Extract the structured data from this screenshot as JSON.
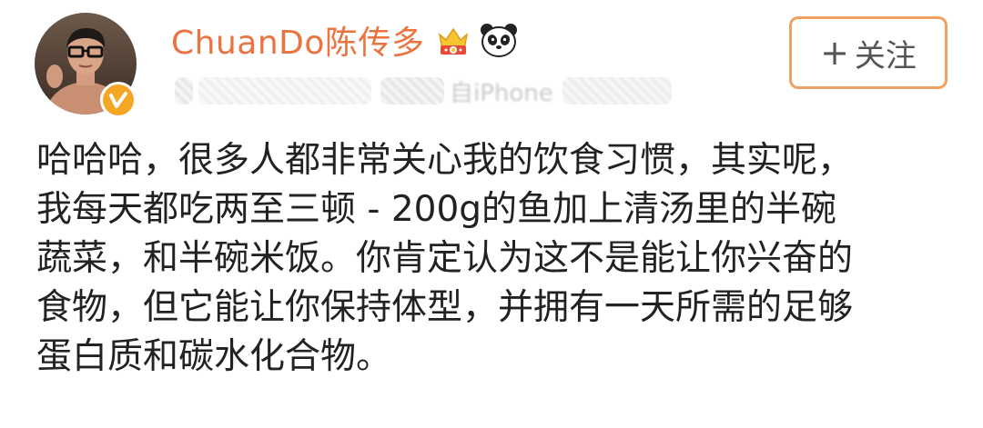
{
  "post": {
    "username": "ChuanDo陈传多",
    "meta_visible_fragment": "自iPhone",
    "follow_label": "关注",
    "follow_plus": "+",
    "body_lines": [
      "哈哈哈，很多人都非常关心我的饮食习惯，其实呢，",
      "我每天都吃两至三顿 - 200g的鱼加上清汤里的半碗",
      "蔬菜，和半碗米饭。你肯定认为这不是能让你兴奋的",
      "食物，但它能让你保持体型，并拥有一天所需的足够",
      "蛋白质和碳水化合物。"
    ]
  },
  "icons": {
    "avatar": "user-avatar",
    "verified": "verified-badge-icon",
    "vip": "crown-badge-icon",
    "panda": "panda-icon"
  },
  "colors": {
    "username": "#eb7340",
    "follow_border": "#f0a060",
    "verified": "#f5a623",
    "body_text": "#222222"
  }
}
